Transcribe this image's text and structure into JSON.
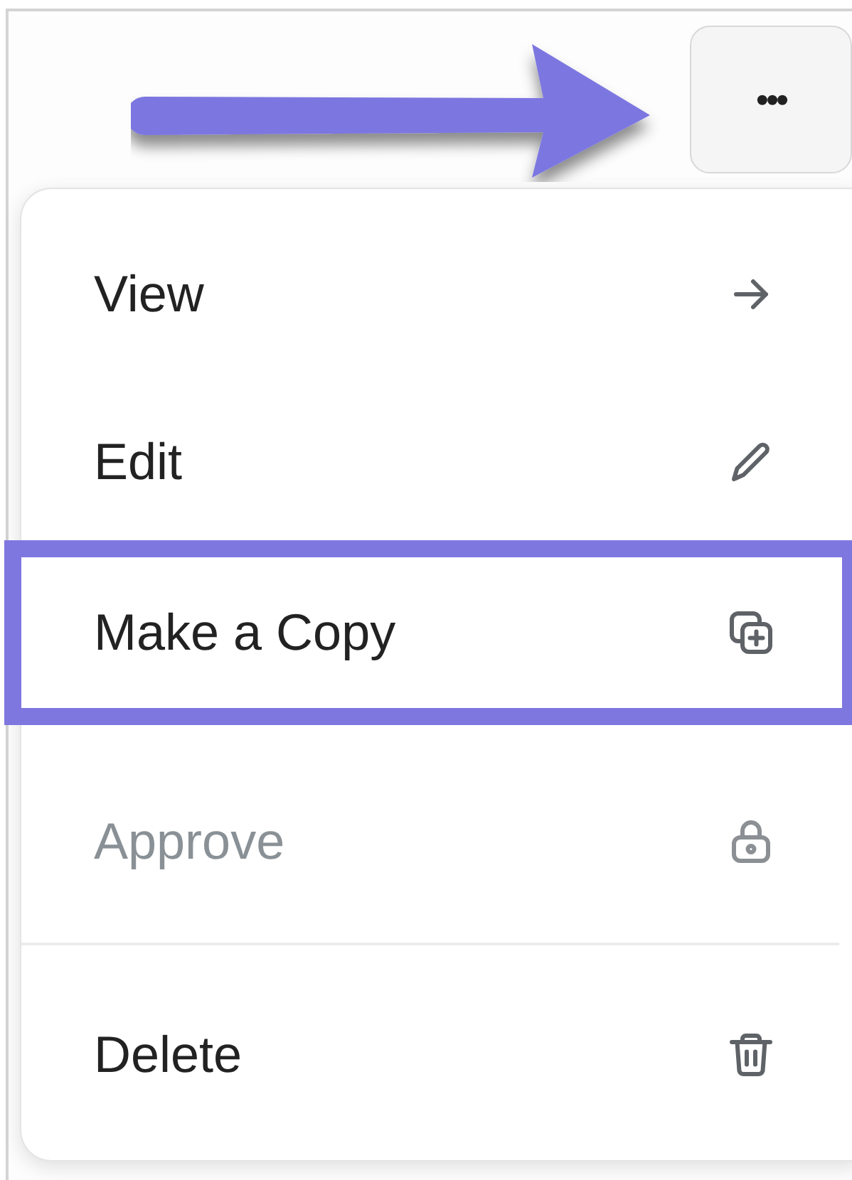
{
  "menu_button": {
    "label": "•••"
  },
  "menu": {
    "items": [
      {
        "label": "View",
        "disabled": false,
        "highlighted": false,
        "divider_before": false
      },
      {
        "label": "Edit",
        "disabled": false,
        "highlighted": false,
        "divider_before": false
      },
      {
        "label": "Make a Copy",
        "disabled": false,
        "highlighted": true,
        "divider_before": false
      },
      {
        "label": "Approve",
        "disabled": true,
        "highlighted": false,
        "divider_before": false
      },
      {
        "label": "Delete",
        "disabled": false,
        "highlighted": false,
        "divider_before": true
      }
    ]
  }
}
